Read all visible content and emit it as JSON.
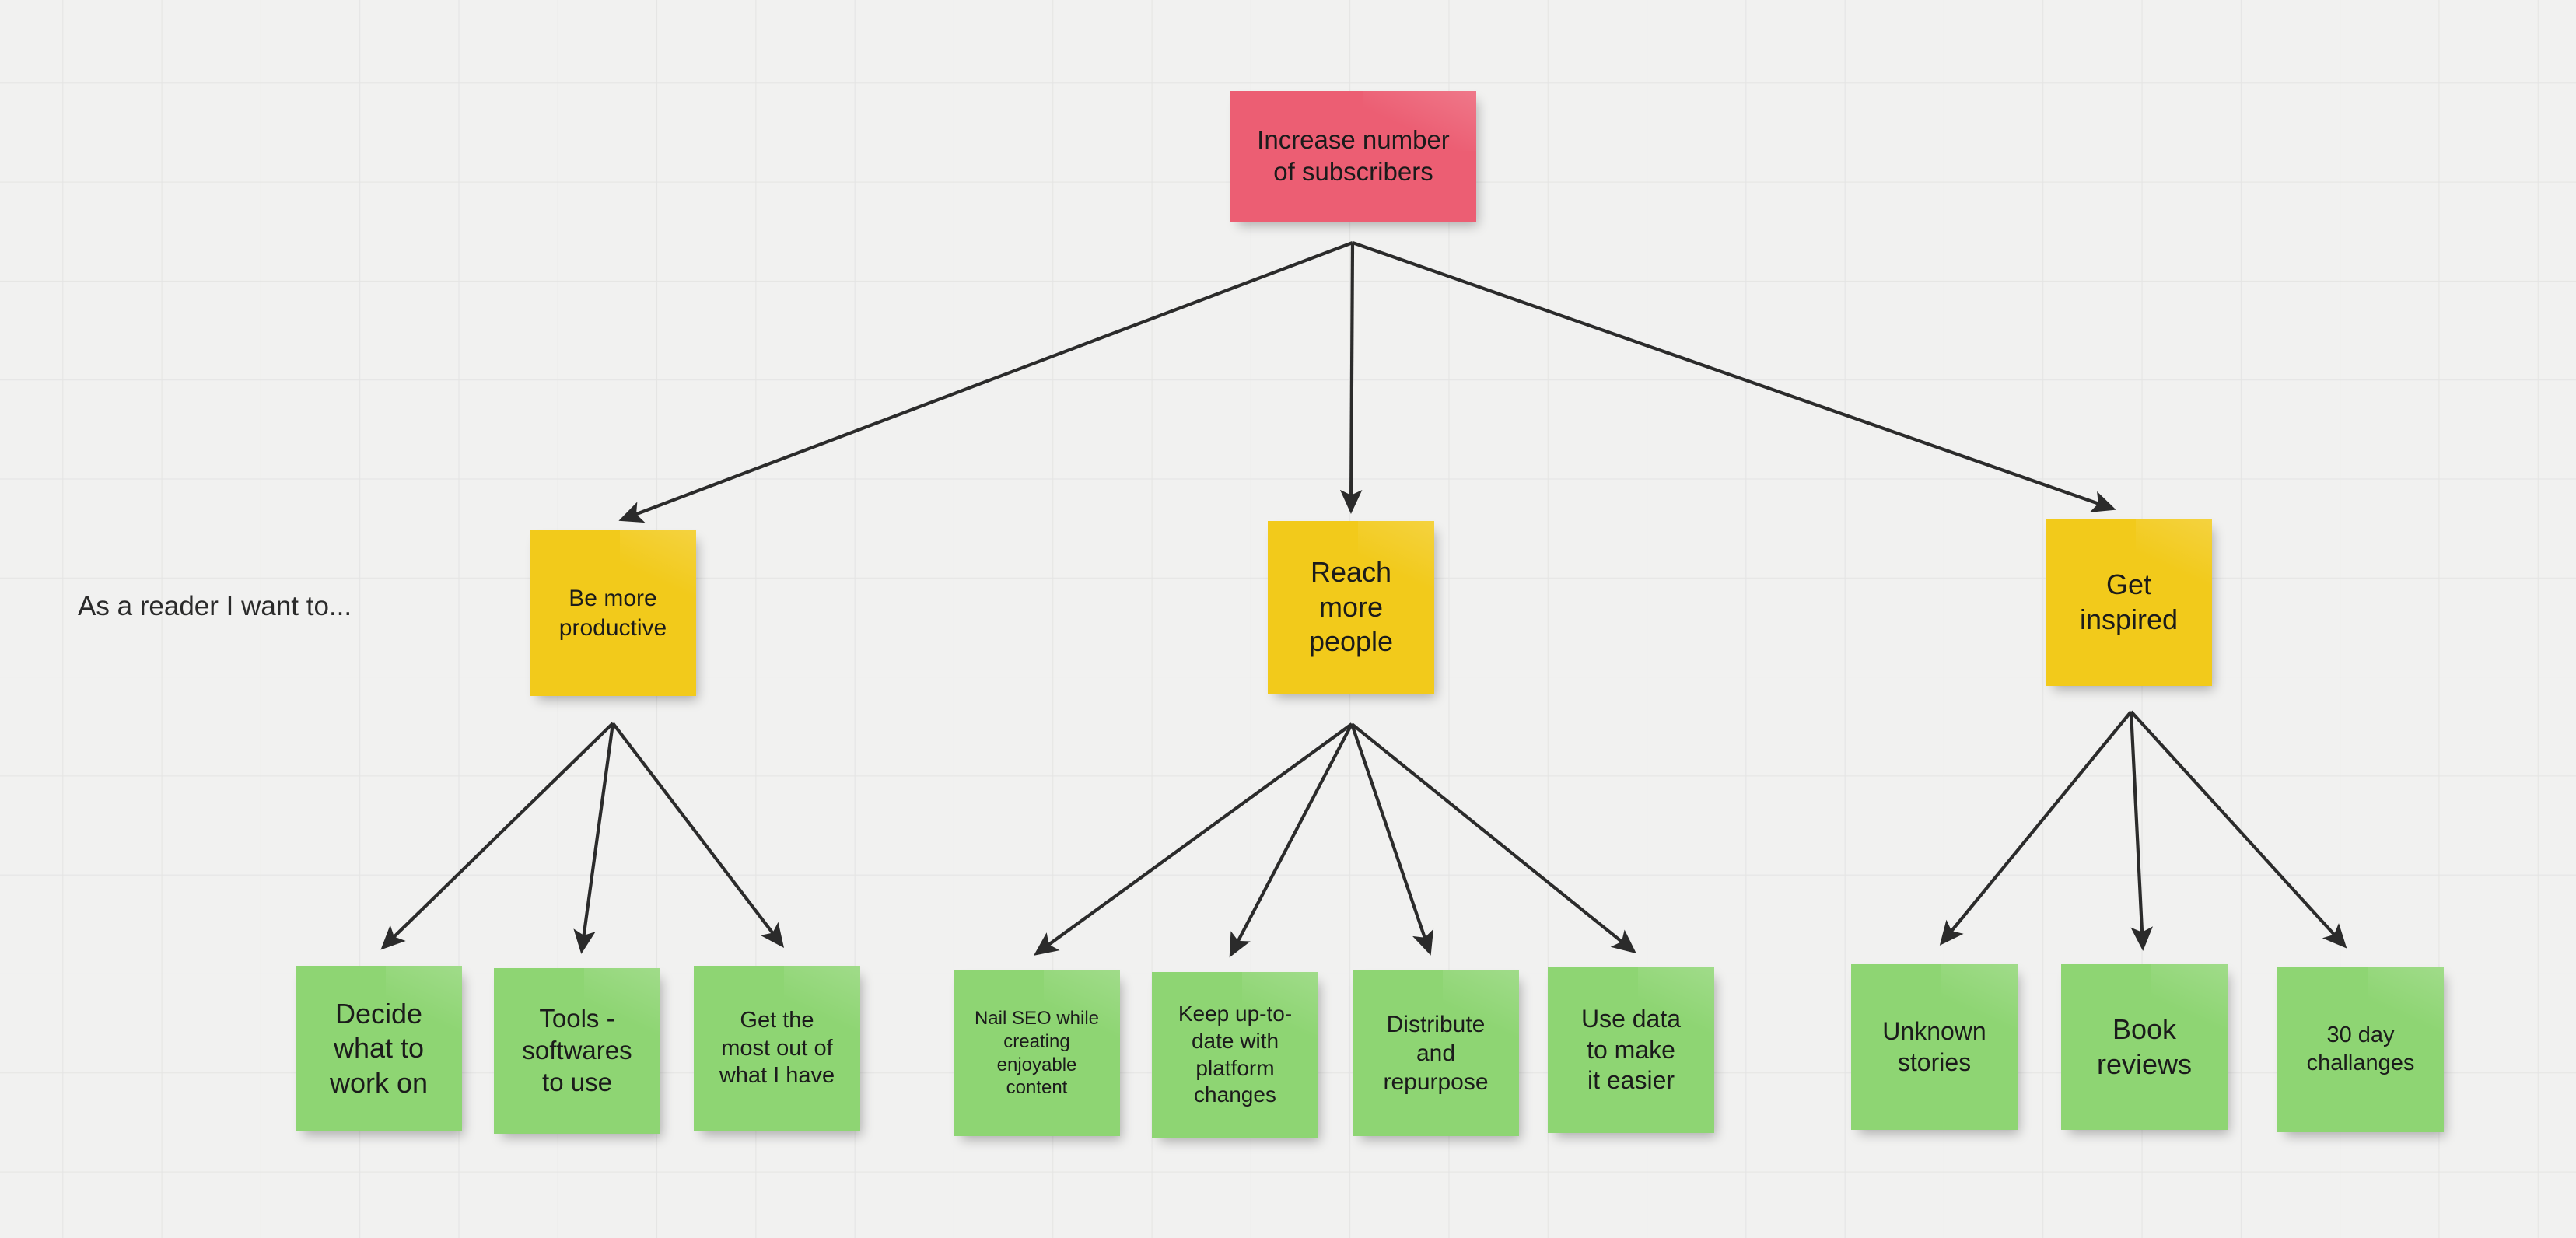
{
  "board": {
    "background_color": "#f1f1f0",
    "grid_line_color": "#e4e4e3",
    "connector_color": "#2b2b2b"
  },
  "persona": {
    "label": "As a reader I want to..."
  },
  "root": {
    "text": "Increase number\nof subscribers",
    "color": "#ec5e73"
  },
  "goals": [
    {
      "text": "Be more\nproductive",
      "color": "#f2ca1b"
    },
    {
      "text": "Reach\nmore\npeople",
      "color": "#f2ca1b"
    },
    {
      "text": "Get\ninspired",
      "color": "#f2ca1b"
    }
  ],
  "ideas": {
    "productive": [
      {
        "text": "Decide\nwhat to\nwork on",
        "color": "#8ed573"
      },
      {
        "text": "Tools -\nsoftwares\nto use",
        "color": "#8ed573"
      },
      {
        "text": "Get the\nmost out of\nwhat I have",
        "color": "#8ed573"
      }
    ],
    "reach": [
      {
        "text": "Nail SEO while\ncreating\nenjoyable\ncontent",
        "color": "#8ed573"
      },
      {
        "text": "Keep up-to-\ndate with\nplatform\nchanges",
        "color": "#8ed573"
      },
      {
        "text": "Distribute\nand\nrepurpose",
        "color": "#8ed573"
      },
      {
        "text": "Use data\nto make\nit easier",
        "color": "#8ed573"
      }
    ],
    "inspired": [
      {
        "text": "Unknown\nstories",
        "color": "#8ed573"
      },
      {
        "text": "Book\nreviews",
        "color": "#8ed573"
      },
      {
        "text": "30 day\nchallanges",
        "color": "#8ed573"
      }
    ]
  }
}
